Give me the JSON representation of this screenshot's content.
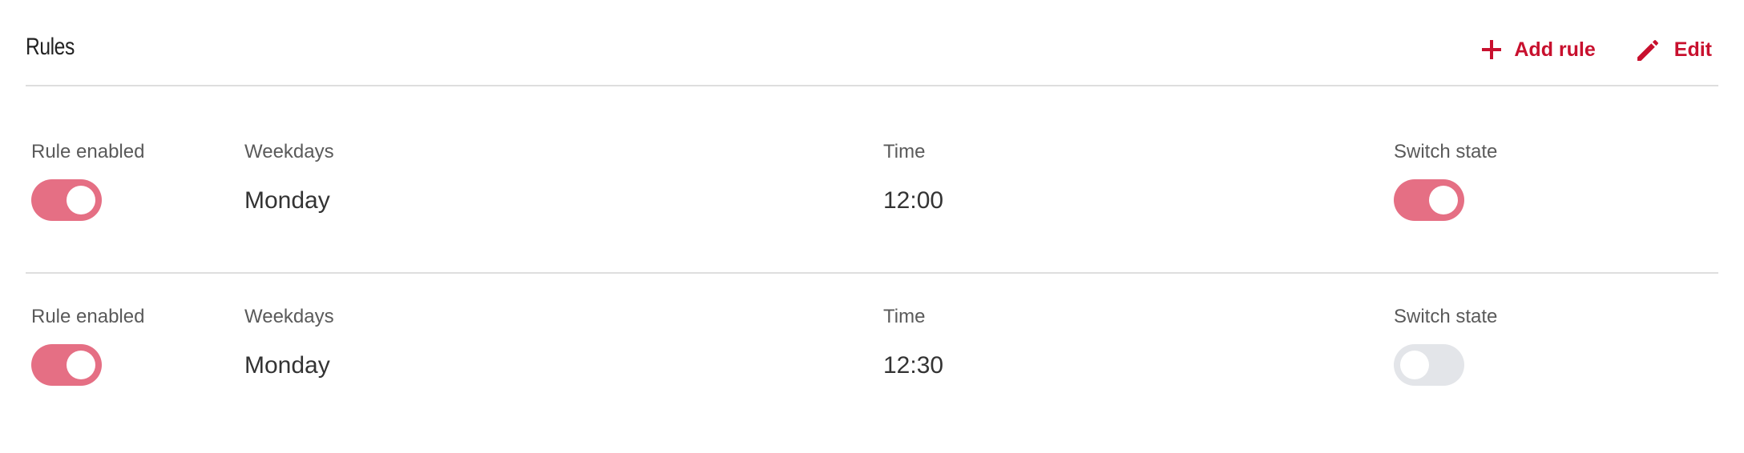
{
  "header": {
    "title": "Rules",
    "add_rule_label": "Add rule",
    "edit_label": "Edit",
    "add_icon": "plus-icon",
    "edit_icon": "pencil-icon"
  },
  "columns": {
    "enabled_label": "Rule enabled",
    "weekdays_label": "Weekdays",
    "time_label": "Time",
    "switch_label": "Switch state"
  },
  "rules": [
    {
      "enabled": true,
      "weekdays": "Monday",
      "time": "12:00",
      "switch_state": true
    },
    {
      "enabled": true,
      "weekdays": "Monday",
      "time": "12:30",
      "switch_state": false
    }
  ],
  "colors": {
    "accent": "#c8102e",
    "toggle_on": "#e56f84",
    "toggle_off": "#e3e5e9",
    "divider": "#dedede"
  }
}
